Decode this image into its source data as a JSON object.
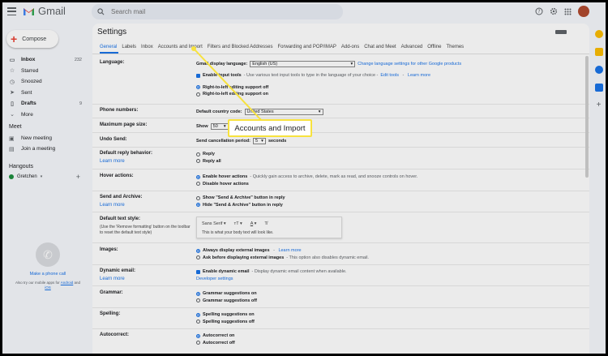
{
  "app": {
    "name": "Gmail"
  },
  "search": {
    "placeholder": "Search mail"
  },
  "compose": {
    "label": "Compose"
  },
  "nav": [
    {
      "label": "Inbox",
      "count": "232",
      "bold": true,
      "icon": "inbox-icon",
      "glyph": "▭"
    },
    {
      "label": "Starred",
      "count": "",
      "bold": false,
      "icon": "star-icon",
      "glyph": "☆"
    },
    {
      "label": "Snoozed",
      "count": "",
      "bold": false,
      "icon": "clock-icon",
      "glyph": "◷"
    },
    {
      "label": "Sent",
      "count": "",
      "bold": false,
      "icon": "send-icon",
      "glyph": "➤"
    },
    {
      "label": "Drafts",
      "count": "9",
      "bold": true,
      "icon": "draft-icon",
      "glyph": "▯"
    },
    {
      "label": "More",
      "count": "",
      "bold": false,
      "icon": "chevron-down-icon",
      "glyph": "⌄"
    }
  ],
  "meet": {
    "title": "Meet",
    "items": [
      {
        "label": "New meeting",
        "icon": "video-icon",
        "glyph": "▣"
      },
      {
        "label": "Join a meeting",
        "icon": "keyboard-icon",
        "glyph": "▤"
      }
    ]
  },
  "hangouts": {
    "title": "Hangouts",
    "user": "Gretchen",
    "add": "+"
  },
  "phone": {
    "link": "Make a phone call",
    "note_prefix": "Also try our mobile apps for",
    "android": "Android",
    "and": "and",
    "ios": "iOS"
  },
  "settings": {
    "title": "Settings",
    "tabs": [
      "General",
      "Labels",
      "Inbox",
      "Accounts and Import",
      "Filters and Blocked Addresses",
      "Forwarding and POP/IMAP",
      "Add-ons",
      "Chat and Meet",
      "Advanced",
      "Offline",
      "Themes"
    ],
    "language": {
      "label": "Language:",
      "display_label": "Gmail display language:",
      "display_value": "English (US)",
      "change_link": "Change language settings for other Google products",
      "input_tools_bold": "Enable input tools",
      "input_tools_desc": " - Use various text input tools to type in the language of your choice - ",
      "edit_tools": "Edit tools",
      "learn_more": "Learn more",
      "rtl_off": "Right-to-left editing support off",
      "rtl_on": "Right-to-left editing support on"
    },
    "phone_numbers": {
      "label": "Phone numbers:",
      "country_label": "Default country code:",
      "country_value": "United States"
    },
    "page_size": {
      "label": "Maximum page size:",
      "show": "Show",
      "value": "50"
    },
    "undo_send": {
      "label": "Undo Send:",
      "period_label": "Send cancellation period:",
      "value": "5",
      "unit": "seconds"
    },
    "reply": {
      "label": "Default reply behavior:",
      "learn_more": "Learn more",
      "opt1": "Reply",
      "opt2": "Reply all"
    },
    "hover": {
      "label": "Hover actions:",
      "opt1_bold": "Enable hover actions",
      "opt1_desc": " - Quickly gain access to archive, delete, mark as read, and snooze controls on hover.",
      "opt2": "Disable hover actions"
    },
    "send_archive": {
      "label": "Send and Archive:",
      "learn_more": "Learn more",
      "opt1": "Show \"Send & Archive\" button in reply",
      "opt2": "Hide \"Send & Archive\" button in reply"
    },
    "text_style": {
      "label": "Default text style:",
      "sub": "(Use the 'Remove formatting' button on the toolbar to reset the default text style)",
      "font": "Sans Serif",
      "sample": "This is what your body text will look like."
    },
    "images": {
      "label": "Images:",
      "opt1_bold": "Always display external images",
      "opt1_link": "Learn more",
      "opt2_bold": "Ask before displaying external images",
      "opt2_desc": " - This option also disables dynamic email."
    },
    "dynamic": {
      "label": "Dynamic email:",
      "learn_more": "Learn more",
      "opt_bold": "Enable dynamic email",
      "opt_desc": " - Display dynamic email content when available.",
      "dev_link": "Developer settings"
    },
    "grammar": {
      "label": "Grammar:",
      "opt1": "Grammar suggestions on",
      "opt2": "Grammar suggestions off"
    },
    "spelling": {
      "label": "Spelling:",
      "opt1": "Spelling suggestions on",
      "opt2": "Spelling suggestions off"
    },
    "autocorrect": {
      "label": "Autocorrect:",
      "opt1": "Autocorrect on",
      "opt2": "Autocorrect off"
    }
  },
  "callout": {
    "text": "Accounts and Import",
    "color": "#f7e23e"
  },
  "colors": {
    "accent": "#1a73e8",
    "brand_red": "#ea4335"
  }
}
